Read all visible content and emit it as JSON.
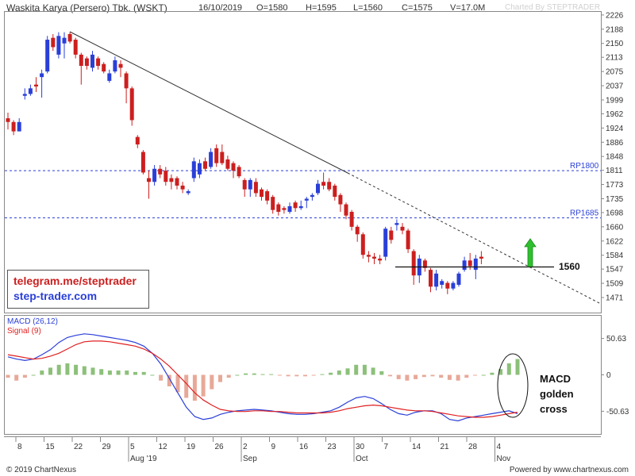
{
  "header": {
    "title": "Waskita Karya (Persero) Tbk. (WSKT)",
    "date": "16/10/2019",
    "open": "O=1580",
    "high": "H=1595",
    "low": "L=1560",
    "close": "C=1575",
    "volume": "V=17.0M",
    "brand": "Charted By STEPTRADER"
  },
  "promo": {
    "line1": "telegram.me/steptrader",
    "line2": "step-trader.com"
  },
  "annotations": {
    "support_label": "1560",
    "resistance1_label": "RP1800",
    "resistance2_label": "RP1685",
    "macd_note": [
      "MACD",
      "golden",
      "cross"
    ]
  },
  "macd_panel": {
    "label_macd": "MACD (26,12)",
    "label_signal": "Signal (9)",
    "ticks": [
      "50.63",
      "0",
      "-50.63"
    ]
  },
  "footer": {
    "copyright": "© 2019 ChartNexus",
    "powered": "Powered by www.chartnexus.com"
  },
  "colors": {
    "up": "#2a3fd8",
    "down": "#cc1f1f",
    "macd": "#2a3fd8",
    "signal": "#e02020",
    "hist_pos": "#8cc07a",
    "hist_neg": "#e8a898",
    "ref_line": "#2a3fd8",
    "arrow": "#2fbf2f"
  },
  "chart_data": [
    {
      "type": "candlestick",
      "title": "Waskita Karya (Persero) Tbk. (WSKT)",
      "y_ticks": [
        2226,
        2188,
        2150,
        2113,
        2075,
        2037,
        1999,
        1962,
        1924,
        1886,
        1848,
        1811,
        1773,
        1735,
        1698,
        1660,
        1622,
        1584,
        1547,
        1509,
        1471
      ],
      "ylim": [
        1435,
        2230
      ],
      "x_ticks": [
        "8",
        "15",
        "22",
        "29",
        "5",
        "12",
        "19",
        "26",
        "2",
        "9",
        "16",
        "23",
        "30",
        "7",
        "14",
        "21",
        "28",
        "4"
      ],
      "x_month_labels": [
        {
          "label": "Aug '19",
          "at_tick": "5"
        },
        {
          "label": "Sep",
          "at_tick": "2"
        },
        {
          "label": "Oct",
          "at_tick": "30"
        },
        {
          "label": "Nov",
          "at_tick": "4"
        }
      ],
      "reference_lines": [
        {
          "label": "RP1800",
          "value": 1811
        },
        {
          "label": "RP1685",
          "value": 1685
        },
        {
          "label": "1560",
          "value": 1565
        }
      ],
      "candles": [
        {
          "o": 1950,
          "h": 1965,
          "l": 1920,
          "c": 1940
        },
        {
          "o": 1940,
          "h": 1945,
          "l": 1905,
          "c": 1915
        },
        {
          "o": 1915,
          "h": 1950,
          "l": 1915,
          "c": 1940
        },
        {
          "o": 2010,
          "h": 2030,
          "l": 2000,
          "c": 2015
        },
        {
          "o": 2015,
          "h": 2040,
          "l": 2010,
          "c": 2030
        },
        {
          "o": 2040,
          "h": 2060,
          "l": 2020,
          "c": 2035
        },
        {
          "o": 2060,
          "h": 2080,
          "l": 2005,
          "c": 2070
        },
        {
          "o": 2075,
          "h": 2170,
          "l": 2070,
          "c": 2160
        },
        {
          "o": 2165,
          "h": 2175,
          "l": 2130,
          "c": 2140
        },
        {
          "o": 2120,
          "h": 2180,
          "l": 2110,
          "c": 2170
        },
        {
          "o": 2150,
          "h": 2180,
          "l": 2110,
          "c": 2165
        },
        {
          "o": 2175,
          "h": 2180,
          "l": 2150,
          "c": 2155
        },
        {
          "o": 2160,
          "h": 2165,
          "l": 2110,
          "c": 2120
        },
        {
          "o": 2120,
          "h": 2125,
          "l": 2040,
          "c": 2090
        },
        {
          "o": 2110,
          "h": 2115,
          "l": 2080,
          "c": 2090
        },
        {
          "o": 2085,
          "h": 2130,
          "l": 2075,
          "c": 2120
        },
        {
          "o": 2110,
          "h": 2115,
          "l": 2080,
          "c": 2090
        },
        {
          "o": 2095,
          "h": 2100,
          "l": 2070,
          "c": 2075
        },
        {
          "o": 2050,
          "h": 2080,
          "l": 2045,
          "c": 2070
        },
        {
          "o": 2075,
          "h": 2115,
          "l": 2070,
          "c": 2105
        },
        {
          "o": 2095,
          "h": 2105,
          "l": 2060,
          "c": 2085
        },
        {
          "o": 2070,
          "h": 2075,
          "l": 1990,
          "c": 2030
        },
        {
          "o": 2030,
          "h": 2035,
          "l": 1930,
          "c": 1945
        },
        {
          "o": 1900,
          "h": 1905,
          "l": 1870,
          "c": 1880
        },
        {
          "o": 1860,
          "h": 1865,
          "l": 1800,
          "c": 1805
        },
        {
          "o": 1790,
          "h": 1810,
          "l": 1735,
          "c": 1780
        },
        {
          "o": 1780,
          "h": 1825,
          "l": 1770,
          "c": 1815
        },
        {
          "o": 1815,
          "h": 1825,
          "l": 1790,
          "c": 1800
        },
        {
          "o": 1810,
          "h": 1820,
          "l": 1770,
          "c": 1780
        },
        {
          "o": 1790,
          "h": 1800,
          "l": 1760,
          "c": 1780
        },
        {
          "o": 1790,
          "h": 1795,
          "l": 1760,
          "c": 1770
        },
        {
          "o": 1770,
          "h": 1780,
          "l": 1750,
          "c": 1760
        },
        {
          "o": 1750,
          "h": 1760,
          "l": 1745,
          "c": 1755
        },
        {
          "o": 1790,
          "h": 1845,
          "l": 1780,
          "c": 1835
        },
        {
          "o": 1800,
          "h": 1840,
          "l": 1790,
          "c": 1830
        },
        {
          "o": 1835,
          "h": 1845,
          "l": 1810,
          "c": 1815
        },
        {
          "o": 1820,
          "h": 1870,
          "l": 1815,
          "c": 1860
        },
        {
          "o": 1870,
          "h": 1880,
          "l": 1820,
          "c": 1830
        },
        {
          "o": 1860,
          "h": 1880,
          "l": 1825,
          "c": 1830
        },
        {
          "o": 1840,
          "h": 1850,
          "l": 1810,
          "c": 1815
        },
        {
          "o": 1830,
          "h": 1835,
          "l": 1790,
          "c": 1810
        },
        {
          "o": 1820,
          "h": 1825,
          "l": 1790,
          "c": 1795
        },
        {
          "o": 1785,
          "h": 1790,
          "l": 1740,
          "c": 1760
        },
        {
          "o": 1760,
          "h": 1790,
          "l": 1740,
          "c": 1785
        },
        {
          "o": 1780,
          "h": 1790,
          "l": 1740,
          "c": 1750
        },
        {
          "o": 1760,
          "h": 1765,
          "l": 1730,
          "c": 1740
        },
        {
          "o": 1755,
          "h": 1760,
          "l": 1720,
          "c": 1730
        },
        {
          "o": 1740,
          "h": 1745,
          "l": 1695,
          "c": 1705
        },
        {
          "o": 1720,
          "h": 1725,
          "l": 1690,
          "c": 1700
        },
        {
          "o": 1710,
          "h": 1715,
          "l": 1695,
          "c": 1705
        },
        {
          "o": 1700,
          "h": 1725,
          "l": 1695,
          "c": 1715
        },
        {
          "o": 1725,
          "h": 1730,
          "l": 1700,
          "c": 1710
        },
        {
          "o": 1710,
          "h": 1730,
          "l": 1705,
          "c": 1715
        },
        {
          "o": 1730,
          "h": 1740,
          "l": 1710,
          "c": 1735
        },
        {
          "o": 1740,
          "h": 1750,
          "l": 1730,
          "c": 1745
        },
        {
          "o": 1750,
          "h": 1785,
          "l": 1745,
          "c": 1775
        },
        {
          "o": 1780,
          "h": 1805,
          "l": 1760,
          "c": 1770
        },
        {
          "o": 1780,
          "h": 1790,
          "l": 1755,
          "c": 1760
        },
        {
          "o": 1770,
          "h": 1775,
          "l": 1730,
          "c": 1740
        },
        {
          "o": 1745,
          "h": 1750,
          "l": 1700,
          "c": 1720
        },
        {
          "o": 1720,
          "h": 1725,
          "l": 1680,
          "c": 1690
        },
        {
          "o": 1700,
          "h": 1705,
          "l": 1650,
          "c": 1660
        },
        {
          "o": 1660,
          "h": 1665,
          "l": 1620,
          "c": 1640
        },
        {
          "o": 1640,
          "h": 1645,
          "l": 1575,
          "c": 1585
        },
        {
          "o": 1585,
          "h": 1595,
          "l": 1565,
          "c": 1580
        },
        {
          "o": 1580,
          "h": 1590,
          "l": 1560,
          "c": 1575
        },
        {
          "o": 1575,
          "h": 1585,
          "l": 1560,
          "c": 1570
        },
        {
          "o": 1580,
          "h": 1660,
          "l": 1570,
          "c": 1655
        },
        {
          "o": 1650,
          "h": 1660,
          "l": 1615,
          "c": 1625
        },
        {
          "o": 1665,
          "h": 1680,
          "l": 1650,
          "c": 1670
        },
        {
          "o": 1660,
          "h": 1670,
          "l": 1640,
          "c": 1650
        },
        {
          "o": 1650,
          "h": 1655,
          "l": 1590,
          "c": 1600
        },
        {
          "o": 1595,
          "h": 1600,
          "l": 1505,
          "c": 1530
        },
        {
          "o": 1530,
          "h": 1585,
          "l": 1510,
          "c": 1575
        },
        {
          "o": 1570,
          "h": 1575,
          "l": 1540,
          "c": 1550
        },
        {
          "o": 1545,
          "h": 1550,
          "l": 1485,
          "c": 1500
        },
        {
          "o": 1500,
          "h": 1545,
          "l": 1490,
          "c": 1535
        },
        {
          "o": 1505,
          "h": 1520,
          "l": 1495,
          "c": 1515
        },
        {
          "o": 1510,
          "h": 1515,
          "l": 1480,
          "c": 1495
        },
        {
          "o": 1495,
          "h": 1515,
          "l": 1490,
          "c": 1510
        },
        {
          "o": 1505,
          "h": 1540,
          "l": 1500,
          "c": 1535
        },
        {
          "o": 1545,
          "h": 1580,
          "l": 1540,
          "c": 1570
        },
        {
          "o": 1570,
          "h": 1590,
          "l": 1545,
          "c": 1555
        },
        {
          "o": 1545,
          "h": 1585,
          "l": 1520,
          "c": 1575
        },
        {
          "o": 1580,
          "h": 1595,
          "l": 1560,
          "c": 1575
        }
      ]
    },
    {
      "type": "line",
      "series": [
        {
          "name": "MACD (26,12)",
          "values": [
            25,
            22,
            20,
            22,
            28,
            35,
            45,
            52,
            55,
            57,
            56,
            54,
            52,
            50,
            48,
            45,
            40,
            30,
            15,
            -5,
            -25,
            -45,
            -58,
            -62,
            -60,
            -55,
            -52,
            -50,
            -49,
            -48,
            -49,
            -50,
            -52,
            -54,
            -55,
            -55,
            -54,
            -52,
            -50,
            -45,
            -38,
            -32,
            -30,
            -33,
            -40,
            -48,
            -54,
            -56,
            -52,
            -50,
            -50,
            -54,
            -62,
            -64,
            -60,
            -58,
            -56,
            -54,
            -52,
            -50,
            -54
          ]
        },
        {
          "name": "Signal (9)",
          "values": [
            28,
            26,
            24,
            22,
            23,
            26,
            30,
            36,
            42,
            46,
            47,
            47,
            46,
            44,
            42,
            40,
            36,
            30,
            22,
            12,
            0,
            -12,
            -25,
            -35,
            -42,
            -48,
            -50,
            -51,
            -51,
            -50,
            -50,
            -51,
            -51,
            -52,
            -53,
            -53,
            -53,
            -53,
            -52,
            -50,
            -47,
            -45,
            -43,
            -42,
            -43,
            -45,
            -47,
            -49,
            -50,
            -50,
            -51,
            -53,
            -55,
            -57,
            -58,
            -59,
            -59,
            -58,
            -56,
            -54,
            -52
          ]
        }
      ],
      "histogram": [
        -4,
        -8,
        -4,
        0,
        6,
        10,
        14,
        16,
        14,
        12,
        10,
        8,
        6,
        6,
        6,
        4,
        4,
        0,
        -8,
        -16,
        -24,
        -32,
        -36,
        -30,
        -20,
        -10,
        -4,
        0,
        2,
        2,
        1,
        1,
        -1,
        -2,
        -2,
        -2,
        -1,
        1,
        3,
        6,
        9,
        14,
        14,
        10,
        5,
        -2,
        -6,
        -8,
        -6,
        -3,
        -2,
        -4,
        -7,
        -8,
        -4,
        -1,
        0,
        3,
        8,
        16,
        22
      ],
      "ylim": [
        -80,
        80
      ],
      "y_ticks": [
        50.63,
        0,
        -50.63
      ]
    }
  ]
}
